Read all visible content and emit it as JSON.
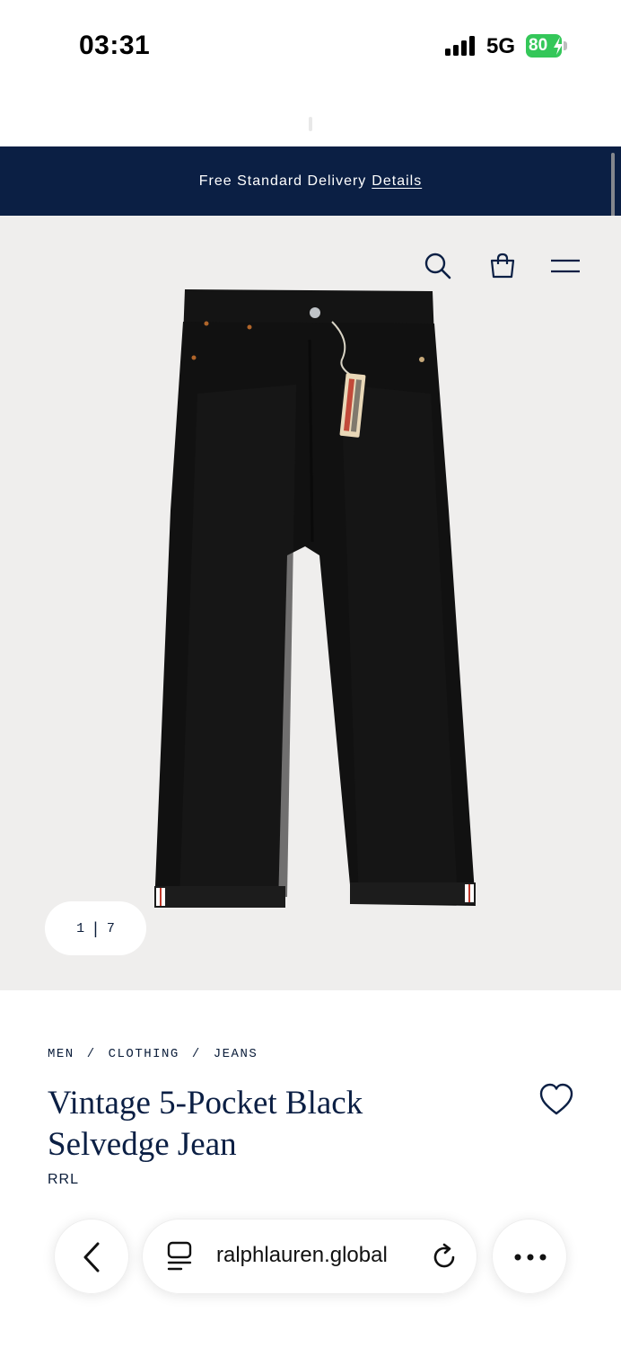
{
  "status_bar": {
    "time": "03:31",
    "network": "5G",
    "battery": "80",
    "battery_color": "#34c759"
  },
  "promo": {
    "text": "Free Standard Delivery",
    "link": "Details",
    "bg_color": "#0b1f44"
  },
  "header": {
    "icons": [
      "search-icon",
      "shopping-bag-icon",
      "menu-icon"
    ]
  },
  "gallery": {
    "current": "1",
    "separator": "|",
    "total": "7",
    "image_bg": "#efeeed"
  },
  "product": {
    "breadcrumb": [
      "MEN",
      "/",
      "CLOTHING",
      "/",
      "JEANS"
    ],
    "title": "Vintage 5-Pocket Black Selvedge Jean",
    "brand": "RRL"
  },
  "browser": {
    "url": "ralphlauren.global",
    "icons": [
      "back-icon",
      "tabs-icon",
      "reload-icon",
      "more-icon"
    ]
  }
}
